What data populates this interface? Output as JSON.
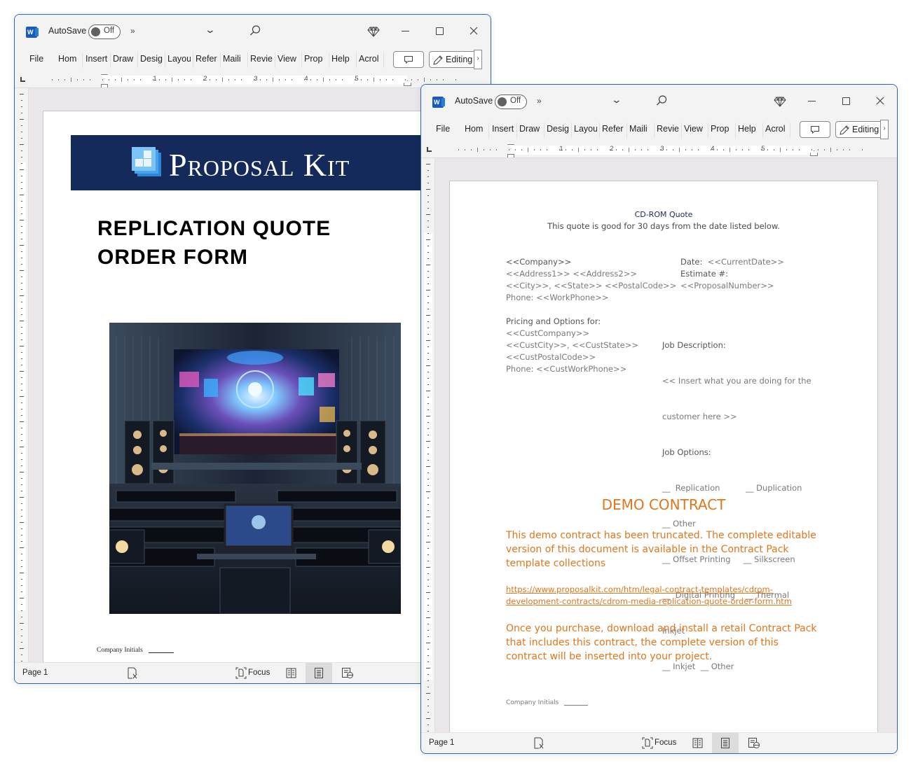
{
  "windows": [
    {
      "id": "left",
      "titlebar": {
        "app_icon": "word-icon",
        "autosave_label": "AutoSave",
        "autosave_state": "Off",
        "more_commands": "»",
        "icons": [
          "chevron-down-icon",
          "search-icon",
          "diamond-icon",
          "minimize-icon",
          "maximize-icon",
          "close-icon"
        ]
      },
      "ribbon": {
        "tabs": [
          "File",
          "Home",
          "Insert",
          "Draw",
          "Design",
          "Layout",
          "References",
          "Mailings",
          "Review",
          "View",
          "Properties",
          "Help",
          "Acrobat"
        ],
        "tabs_visible": [
          "File",
          "Hom",
          "Insert",
          "Draw",
          "Desig",
          "Layou",
          "Refer",
          "Maili",
          "Revie",
          "View",
          "Prop",
          "Help",
          "Acrol"
        ],
        "comment_icon": "comment-icon",
        "editing_label": "Editing",
        "editing_more": "›"
      },
      "ruler": {
        "numbers": [
          "1",
          "2",
          "3",
          "4",
          "5"
        ]
      },
      "vruler": {
        "numbers": [
          "1",
          "2",
          "3",
          "4",
          "5",
          "6",
          "7",
          "8"
        ]
      },
      "page": {
        "banner_text": "Proposal Kit",
        "title_line1": "REPLICATION QUOTE",
        "title_line2": "ORDER FORM",
        "image_description": "Theater with large screen, speakers, seating and desk with computer monitor",
        "initials_label": "Company Initials"
      },
      "statusbar": {
        "page_label": "Page 1",
        "focus_label": "Focus",
        "view_modes": [
          "read-mode",
          "print-layout",
          "web-layout"
        ],
        "active_view": "print-layout"
      }
    },
    {
      "id": "right",
      "titlebar": {
        "app_icon": "word-icon",
        "autosave_label": "AutoSave",
        "autosave_state": "Off",
        "more_commands": "»",
        "icons": [
          "chevron-down-icon",
          "search-icon",
          "diamond-icon",
          "minimize-icon",
          "maximize-icon",
          "close-icon"
        ]
      },
      "ribbon": {
        "tabs": [
          "File",
          "Home",
          "Insert",
          "Draw",
          "Design",
          "Layout",
          "References",
          "Mailings",
          "Review",
          "View",
          "Properties",
          "Help",
          "Acrobat"
        ],
        "tabs_visible": [
          "File",
          "Hom",
          "Insert",
          "Draw",
          "Desig",
          "Layou",
          "Refer",
          "Maili",
          "Revie",
          "View",
          "Prop",
          "Help",
          "Acrol"
        ],
        "comment_icon": "comment-icon",
        "editing_label": "Editing",
        "editing_more": "›"
      },
      "ruler": {
        "numbers": [
          "1",
          "2",
          "3",
          "4",
          "5"
        ]
      },
      "vruler": {
        "numbers": [
          "1",
          "2",
          "3",
          "4",
          "5",
          "6",
          "7",
          "8"
        ]
      },
      "page": {
        "heading": "CD-ROM Quote",
        "subheading": "This quote is good for 30 days from the date listed below.",
        "company_block": {
          "company": "<<Company>>",
          "address": "<<Address1>> <<Address2>>",
          "city_state_zip": "<<City>>, <<State>> <<PostalCode>>",
          "phone": "Phone: <<WorkPhone>>"
        },
        "date_block": {
          "date_label": "Date:",
          "date_value": "<<CurrentDate>>",
          "estimate_label": "Estimate #:",
          "estimate_value": "<<ProposalNumber>>"
        },
        "pricing_block": {
          "label": "Pricing and Options for:",
          "company": "<<CustCompany>>",
          "city_state": "<<CustCity>>, <<CustState>>",
          "postal": "<<CustPostalCode>>",
          "phone": "Phone: <<CustWorkPhone>>"
        },
        "job_block": {
          "desc_label": "Job Description:",
          "desc_line1": "<< Insert what you are doing for the",
          "desc_line2": "customer here >>",
          "options_label": "Job Options:",
          "options_lines": [
            "__  Replication          __ Duplication",
            "__ Other",
            "__ Offset Printing     __ Silkscreen",
            "__  Digital Printing    __ Thermal",
            "Inkjet",
            "__ Inkjet  __ Other"
          ]
        },
        "demo": {
          "title": "DEMO CONTRACT",
          "para1": "This demo contract has been truncated. The complete editable version of this document is available in the Contract Pack template collections",
          "link": "https://www.proposalkit.com/htm/legal-contract-templates/cdrom-development-contracts/cdrom-media-replication-quote-order-form.htm",
          "para2": "Once you purchase, download and install a retail Contract Pack that includes this contract, the complete version of this contract will be inserted into your project."
        },
        "initials_label": "Company Initials"
      },
      "statusbar": {
        "page_label": "Page 1",
        "focus_label": "Focus",
        "view_modes": [
          "read-mode",
          "print-layout",
          "web-layout"
        ],
        "active_view": "print-layout"
      }
    }
  ],
  "colors": {
    "window_border": "#2c63b4",
    "chrome_bg": "#f3f3f3",
    "doc_bg": "#ebe6e9",
    "banner_navy": "#142a5a",
    "demo_orange": "#e0761a",
    "word_blue": "#185abd"
  }
}
